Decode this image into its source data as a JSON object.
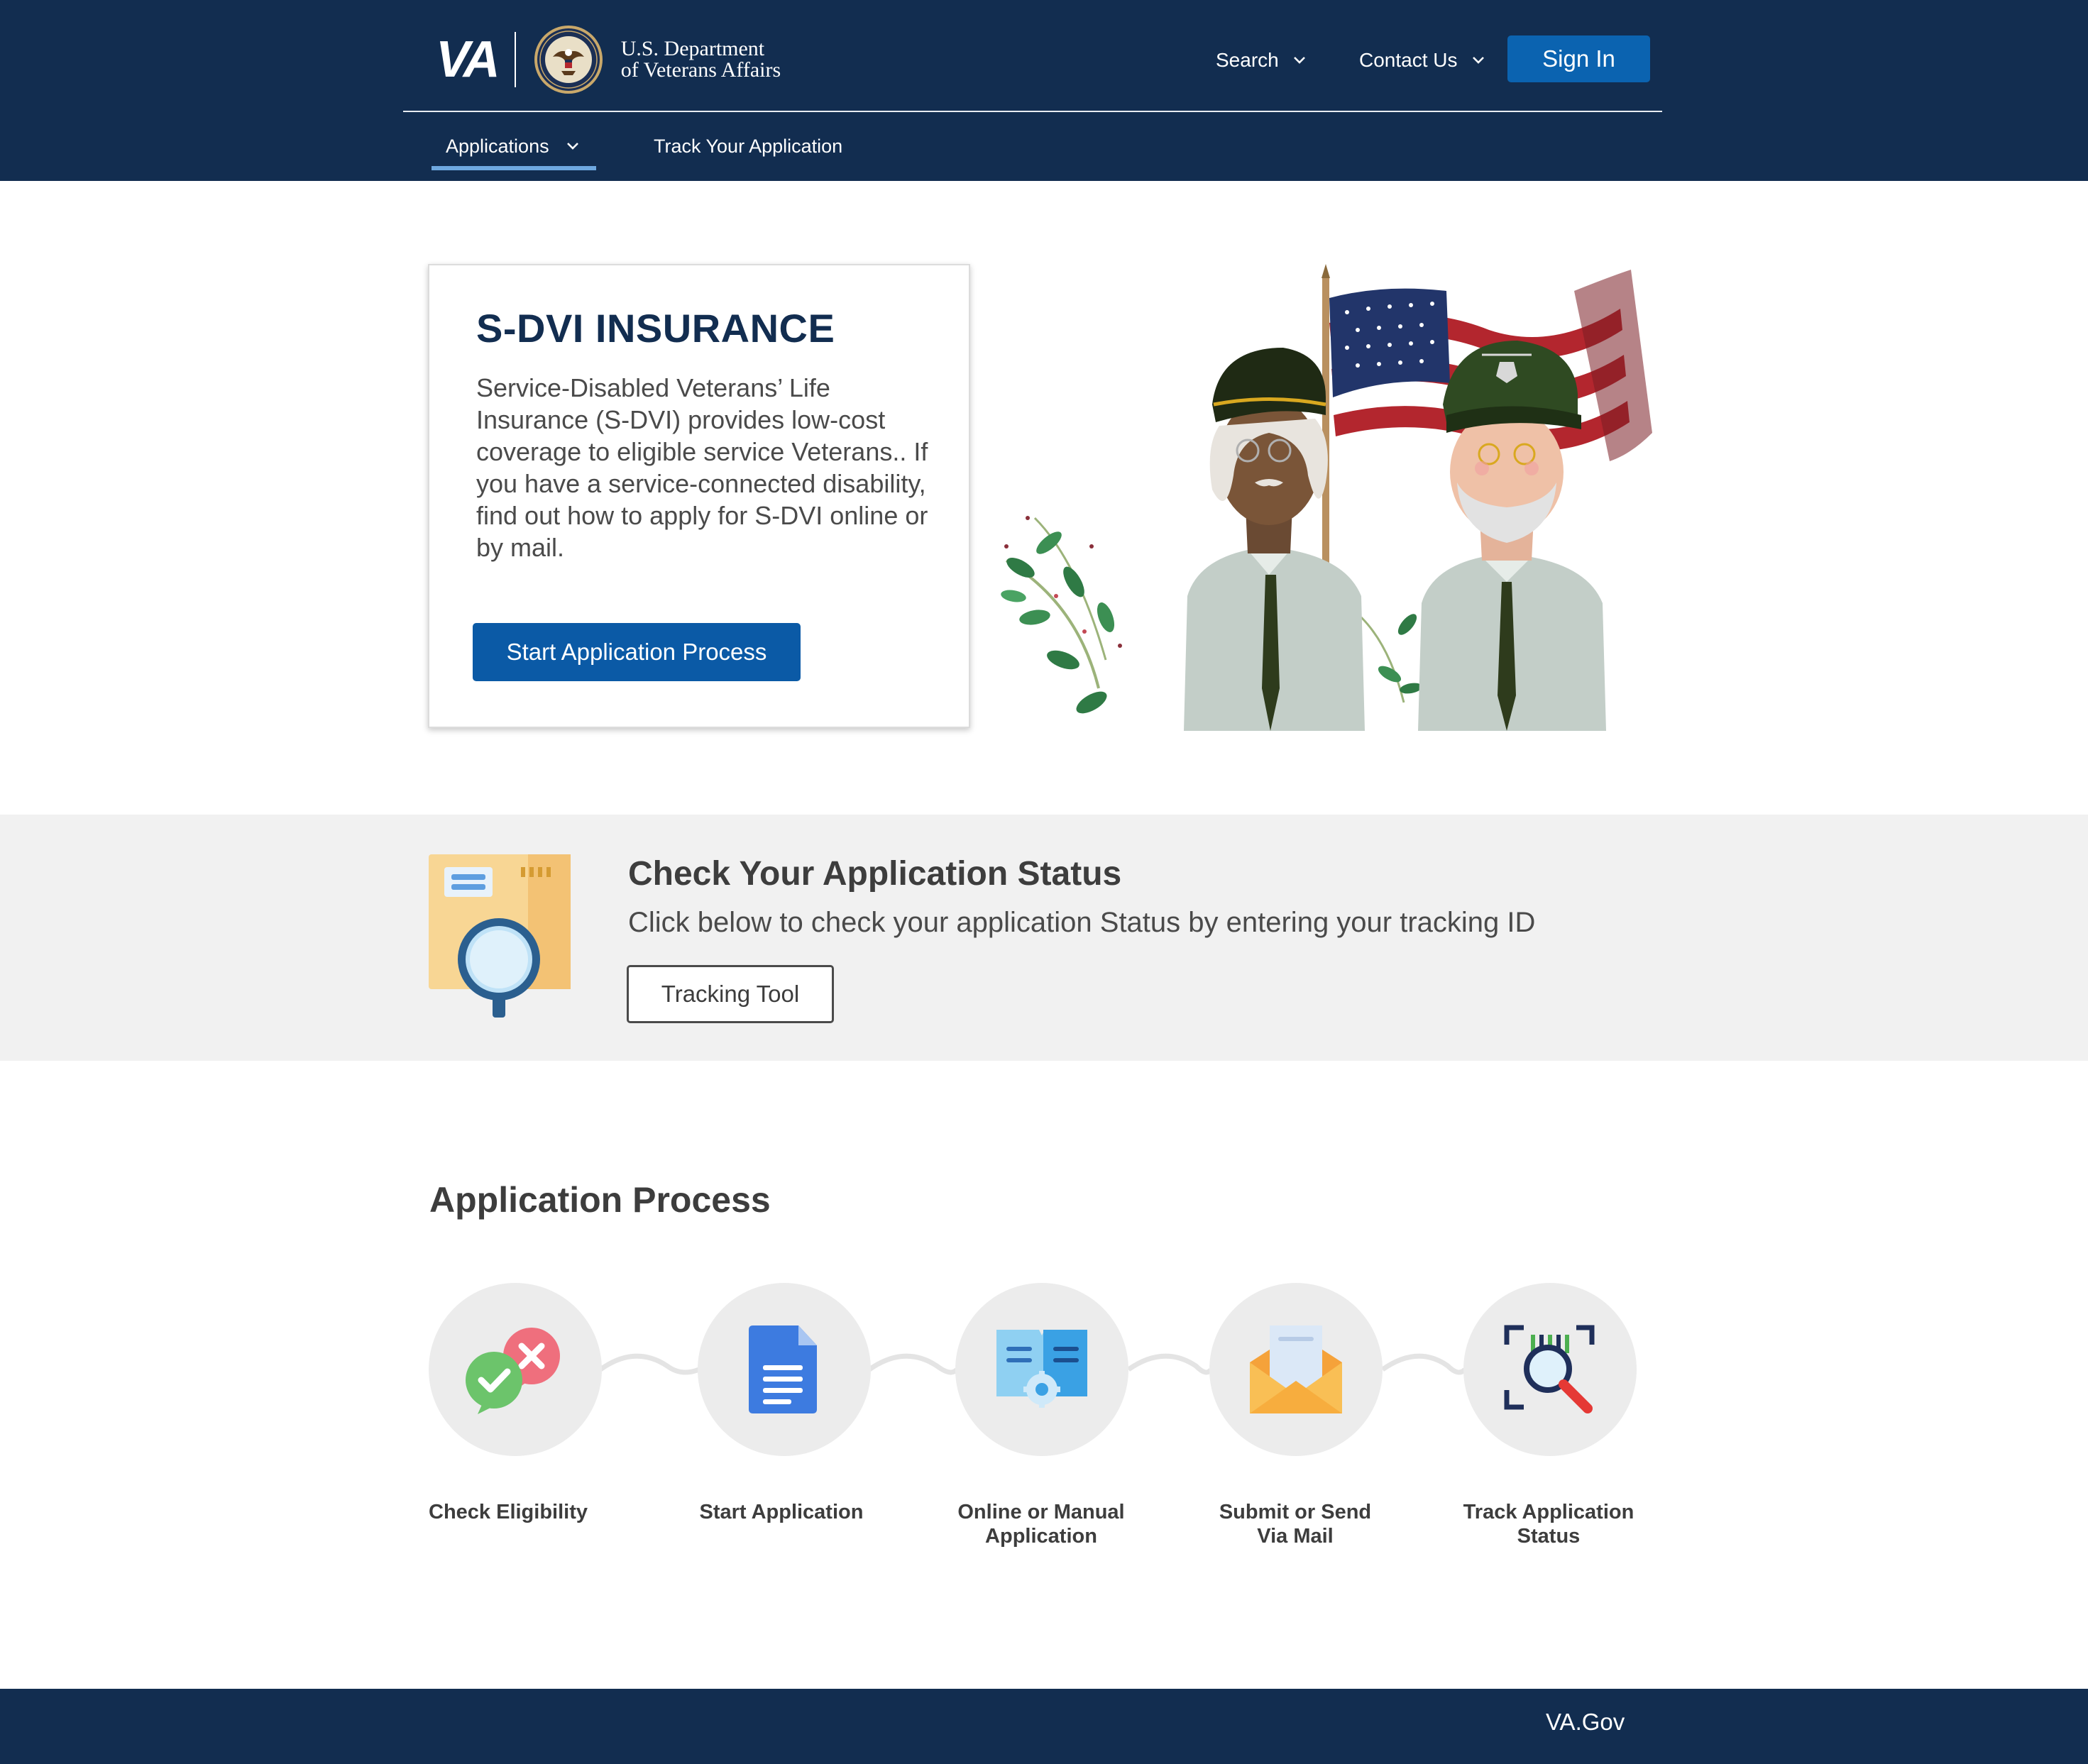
{
  "header": {
    "logo_letters": "VA",
    "department_line1": "U.S. Department",
    "department_line2": "of Veterans Affairs",
    "nav": {
      "search_label": "Search",
      "contact_label": "Contact Us",
      "sign_in_label": "Sign In"
    },
    "tabs": [
      {
        "label": "Applications",
        "active": true,
        "icon": "chevron-down-icon"
      },
      {
        "label": "Track Your Application",
        "active": false
      }
    ]
  },
  "hero": {
    "title": "S-DVI INSURANCE",
    "description": "Service-Disabled Veterans’ Life Insurance (S-DVI) provides low-cost coverage to eligible service Veterans.. If you have a service-connected disability, find out how to apply for S-DVI online or by mail.",
    "cta_label": "Start Application Process"
  },
  "status": {
    "title": "Check Your Application Status",
    "description": "Click below to check your application Status by entering your tracking ID",
    "button_label": "Tracking Tool"
  },
  "process": {
    "title": "Application Process",
    "steps": [
      {
        "line1": "Check Eligibility",
        "line2": "",
        "icon": "chat-check-cross-icon"
      },
      {
        "line1": "Start Application",
        "line2": "",
        "icon": "document-icon"
      },
      {
        "line1": "Online or Manual",
        "line2": "Application",
        "icon": "book-gear-icon"
      },
      {
        "line1": "Submit or Send",
        "line2": "Via Mail",
        "icon": "envelope-icon"
      },
      {
        "line1": "Track Application",
        "line2": "Status",
        "icon": "magnifier-scan-icon"
      }
    ]
  },
  "footer": {
    "link_label": "VA.Gov"
  },
  "colors": {
    "navy": "#122d50",
    "primary_blue": "#0b5aa6",
    "tab_underline": "#6ea8e0",
    "band_gray": "#f1f1f1",
    "circle_gray": "#ececec"
  }
}
